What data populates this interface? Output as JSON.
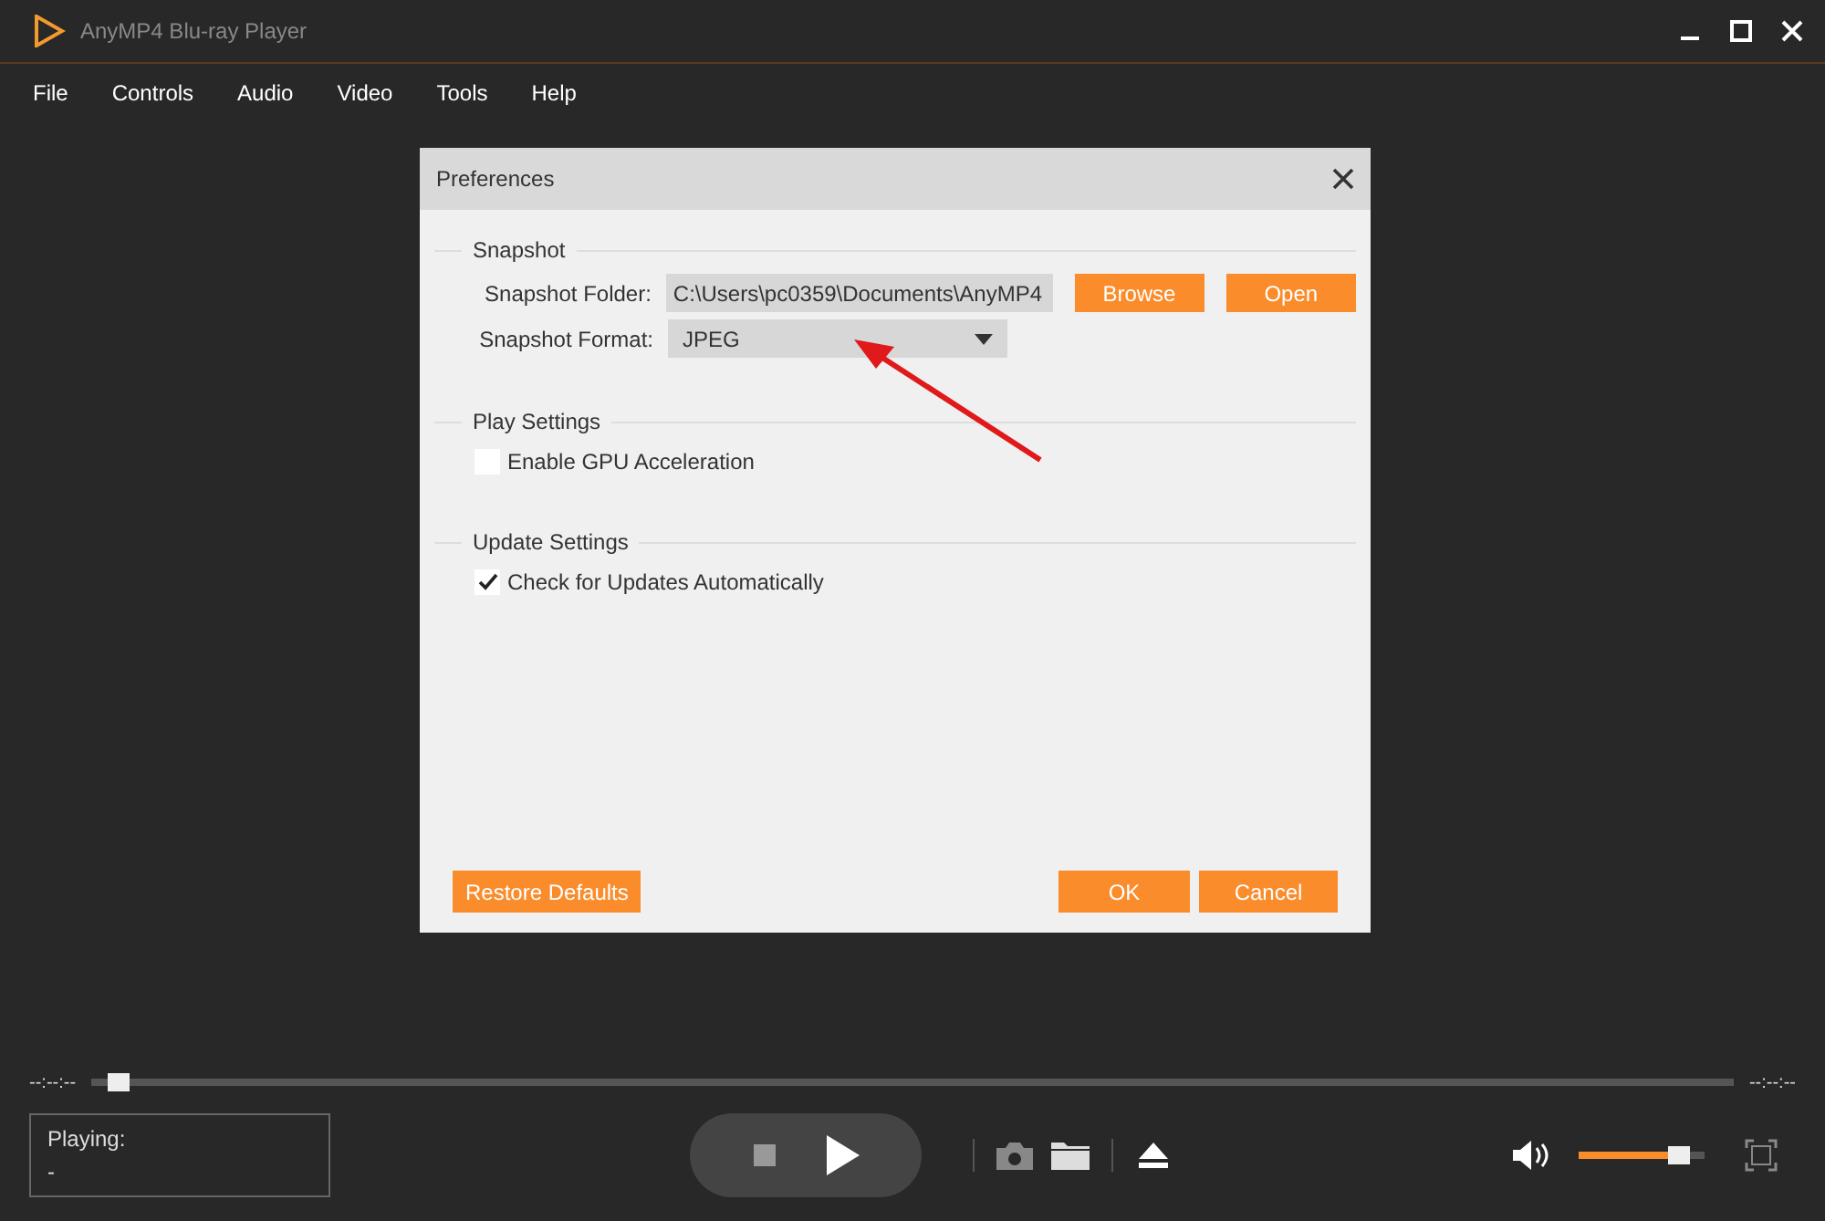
{
  "window": {
    "title": "AnyMP4 Blu-ray Player"
  },
  "menu": [
    "File",
    "Controls",
    "Audio",
    "Video",
    "Tools",
    "Help"
  ],
  "dialog": {
    "title": "Preferences",
    "sections": [
      {
        "title": "Snapshot",
        "rows": [
          {
            "kind": "folder",
            "label": "Snapshot Folder:",
            "value": "C:\\Users\\pc0359\\Documents\\AnyMP4",
            "buttons": [
              "Browse",
              "Open"
            ]
          },
          {
            "kind": "select",
            "label": "Snapshot Format:",
            "value": "JPEG"
          }
        ]
      },
      {
        "title": "Play Settings",
        "rows": [
          {
            "kind": "checkbox",
            "label": "Enable GPU Acceleration",
            "checked": false
          }
        ]
      },
      {
        "title": "Update Settings",
        "rows": [
          {
            "kind": "checkbox",
            "label": "Check for Updates Automatically",
            "checked": true
          }
        ]
      }
    ],
    "restore_button": "Restore Defaults",
    "ok_button": "OK",
    "cancel_button": "Cancel"
  },
  "player": {
    "elapsed": "--:--:--",
    "remaining": "--:--:--",
    "progress": {
      "level": 0.01
    },
    "status_label": "Playing:",
    "status_value": "-",
    "volume": {
      "level": 0.8
    }
  }
}
